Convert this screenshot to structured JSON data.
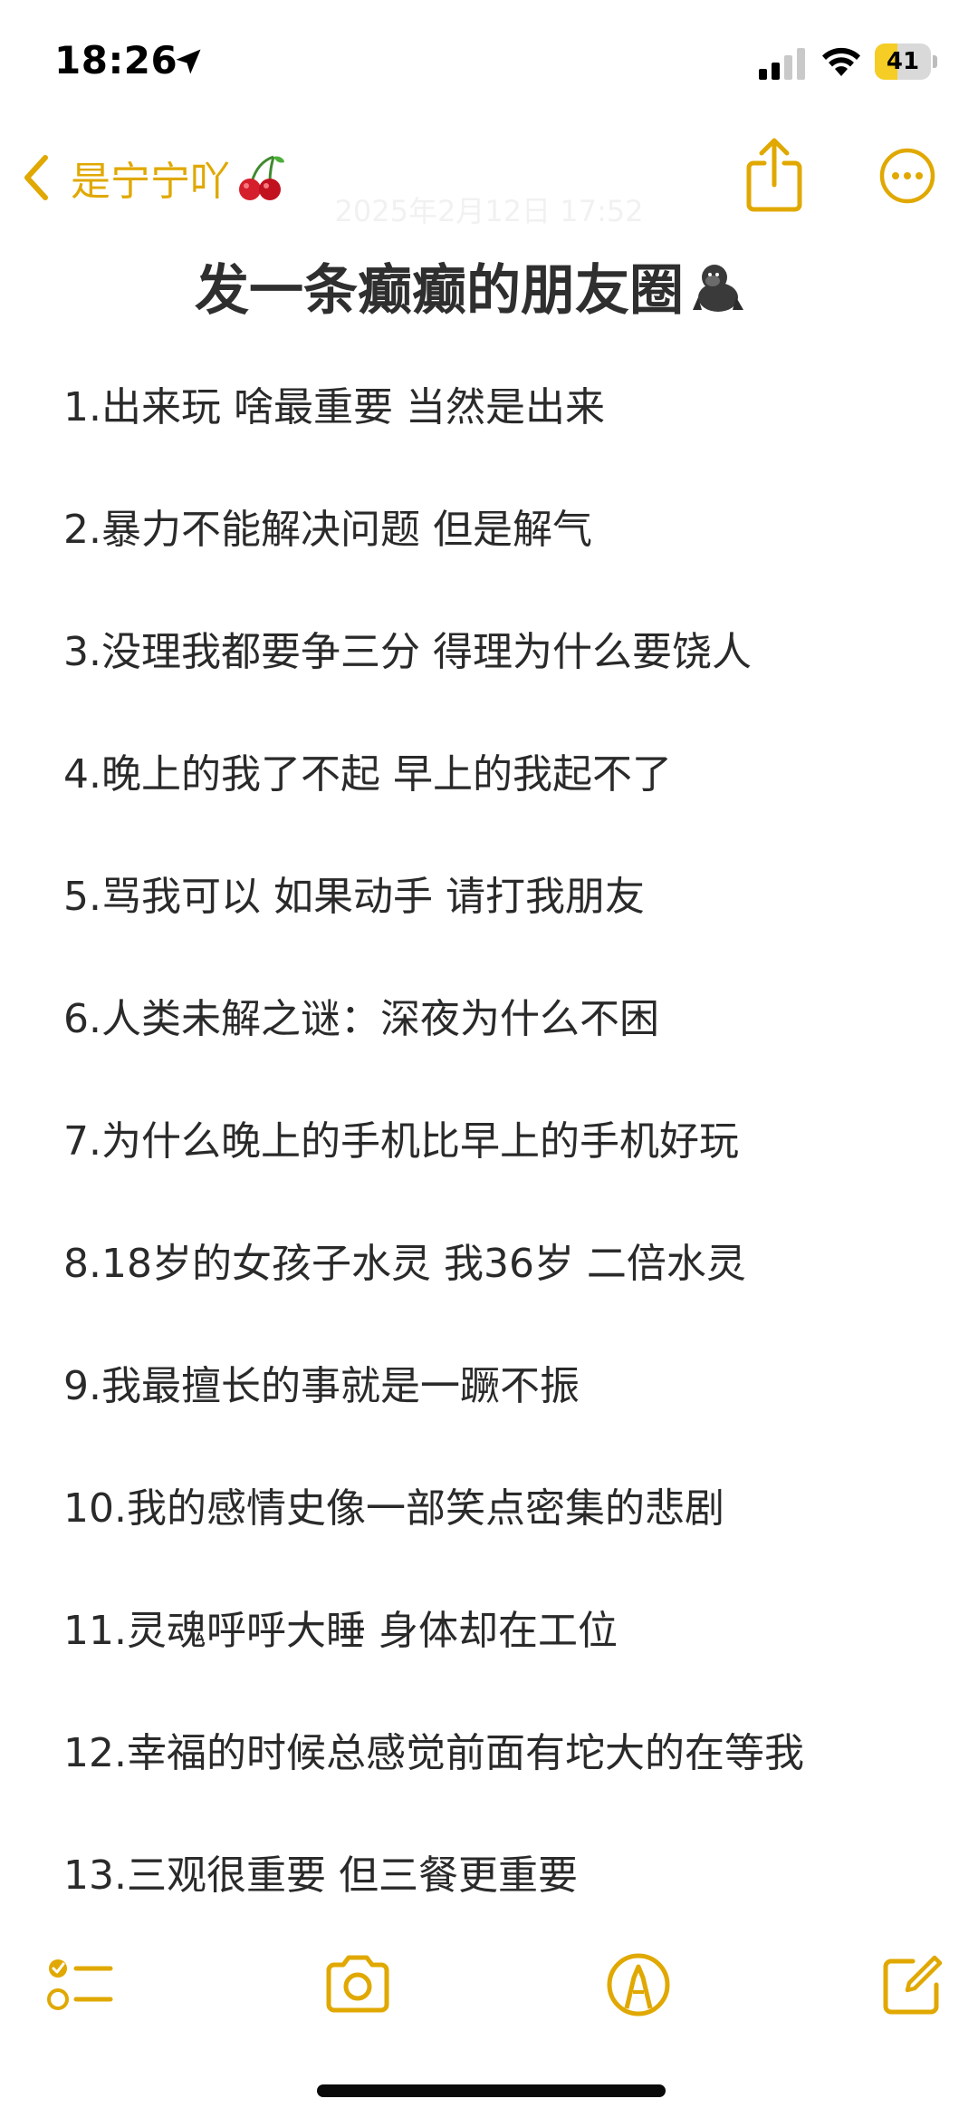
{
  "status_bar": {
    "time": "18:26",
    "battery_percent": 41,
    "battery_label": "41",
    "location_icon": "location-arrow-icon",
    "signal_icon": "cellular-signal-icon",
    "wifi_icon": "wifi-icon"
  },
  "nav": {
    "back_label": "是宁宁吖",
    "back_emoji_icon": "cherry-icon",
    "share_icon": "share-icon",
    "more_icon": "more-ellipsis-icon"
  },
  "note": {
    "date": "2025年2月12日 17:52",
    "title": "发一条癫癫的朋友圈",
    "title_emoji_icon": "gorilla-icon",
    "items": [
      "1.出来玩 啥最重要 当然是出来",
      "2.暴力不能解决问题 但是解气",
      "3.没理我都要争三分 得理为什么要饶人",
      "4.晚上的我了不起 早上的我起不了",
      "5.骂我可以 如果动手 请打我朋友",
      "6.人类未解之谜：深夜为什么不困",
      "7.为什么晚上的手机比早上的手机好玩",
      "8.18岁的女孩子水灵 我36岁 二倍水灵",
      "9.我最擅长的事就是一蹶不振",
      "10.我的感情史像一部笑点密集的悲剧",
      "11.灵魂呼呼大睡 身体却在工位",
      "12.幸福的时候总感觉前面有坨大的在等我",
      "13.三观很重要 但三餐更重要"
    ]
  },
  "toolbar": {
    "checklist_icon": "checklist-icon",
    "camera_icon": "camera-icon",
    "markup_icon": "markup-pen-icon",
    "compose_icon": "compose-icon"
  },
  "colors": {
    "accent": "#e0a800",
    "text": "#2a2a2a",
    "battery_fill": "#f5cd24"
  }
}
